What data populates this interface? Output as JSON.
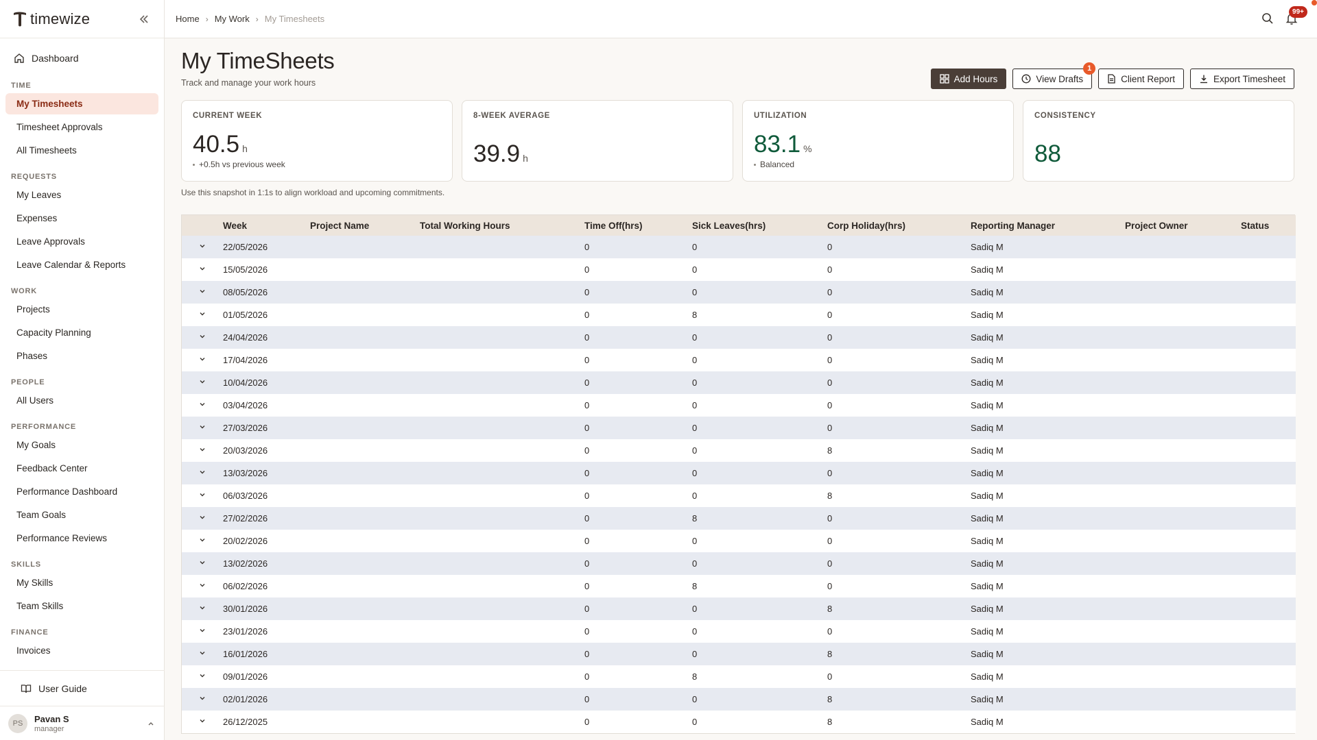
{
  "brand": {
    "name": "timewize"
  },
  "sidebar": {
    "dashboard": "Dashboard",
    "sections": [
      {
        "title": "TIME",
        "items": [
          "My Timesheets",
          "Timesheet Approvals",
          "All Timesheets"
        ]
      },
      {
        "title": "REQUESTS",
        "items": [
          "My Leaves",
          "Expenses",
          "Leave Approvals",
          "Leave Calendar & Reports"
        ]
      },
      {
        "title": "WORK",
        "items": [
          "Projects",
          "Capacity Planning",
          "Phases"
        ]
      },
      {
        "title": "PEOPLE",
        "items": [
          "All Users"
        ]
      },
      {
        "title": "PERFORMANCE",
        "items": [
          "My Goals",
          "Feedback Center",
          "Performance Dashboard",
          "Team Goals",
          "Performance Reviews"
        ]
      },
      {
        "title": "SKILLS",
        "items": [
          "My Skills",
          "Team Skills"
        ]
      },
      {
        "title": "FINANCE",
        "items": [
          "Invoices"
        ]
      }
    ],
    "active_item": "My Timesheets",
    "user_guide": "User Guide",
    "user": {
      "initials": "PS",
      "name": "Pavan S",
      "role": "manager"
    }
  },
  "breadcrumb": [
    "Home",
    "My Work",
    "My Timesheets"
  ],
  "notifications": {
    "badge": "99+"
  },
  "page": {
    "title": "My TimeSheets",
    "subtitle": "Track and manage your work hours",
    "hint": "Use this snapshot in 1:1s to align workload and upcoming commitments."
  },
  "actions": {
    "add_hours": "Add Hours",
    "view_drafts": "View Drafts",
    "drafts_count": "1",
    "client_report": "Client Report",
    "export": "Export Timesheet"
  },
  "stats": [
    {
      "label": "CURRENT WEEK",
      "value": "40.5",
      "unit": "h",
      "note": "+0.5h vs previous week",
      "green": false
    },
    {
      "label": "8-WEEK AVERAGE",
      "value": "39.9",
      "unit": "h",
      "note": "",
      "green": false
    },
    {
      "label": "UTILIZATION",
      "value": "83.1",
      "unit": "%",
      "note": "Balanced",
      "green": true
    },
    {
      "label": "CONSISTENCY",
      "value": "88",
      "unit": "",
      "note": "",
      "green": true
    }
  ],
  "table": {
    "columns": [
      "Week",
      "Project Name",
      "Total Working Hours",
      "Time Off(hrs)",
      "Sick Leaves(hrs)",
      "Corp Holiday(hrs)",
      "Reporting Manager",
      "Project Owner",
      "Status"
    ],
    "rows": [
      [
        "22/05/2026",
        "",
        "",
        "0",
        "0",
        "0",
        "Sadiq M",
        "",
        ""
      ],
      [
        "15/05/2026",
        "",
        "",
        "0",
        "0",
        "0",
        "Sadiq M",
        "",
        ""
      ],
      [
        "08/05/2026",
        "",
        "",
        "0",
        "0",
        "0",
        "Sadiq M",
        "",
        ""
      ],
      [
        "01/05/2026",
        "",
        "",
        "0",
        "8",
        "0",
        "Sadiq M",
        "",
        ""
      ],
      [
        "24/04/2026",
        "",
        "",
        "0",
        "0",
        "0",
        "Sadiq M",
        "",
        ""
      ],
      [
        "17/04/2026",
        "",
        "",
        "0",
        "0",
        "0",
        "Sadiq M",
        "",
        ""
      ],
      [
        "10/04/2026",
        "",
        "",
        "0",
        "0",
        "0",
        "Sadiq M",
        "",
        ""
      ],
      [
        "03/04/2026",
        "",
        "",
        "0",
        "0",
        "0",
        "Sadiq M",
        "",
        ""
      ],
      [
        "27/03/2026",
        "",
        "",
        "0",
        "0",
        "0",
        "Sadiq M",
        "",
        ""
      ],
      [
        "20/03/2026",
        "",
        "",
        "0",
        "0",
        "8",
        "Sadiq M",
        "",
        ""
      ],
      [
        "13/03/2026",
        "",
        "",
        "0",
        "0",
        "0",
        "Sadiq M",
        "",
        ""
      ],
      [
        "06/03/2026",
        "",
        "",
        "0",
        "0",
        "8",
        "Sadiq M",
        "",
        ""
      ],
      [
        "27/02/2026",
        "",
        "",
        "0",
        "8",
        "0",
        "Sadiq M",
        "",
        ""
      ],
      [
        "20/02/2026",
        "",
        "",
        "0",
        "0",
        "0",
        "Sadiq M",
        "",
        ""
      ],
      [
        "13/02/2026",
        "",
        "",
        "0",
        "0",
        "0",
        "Sadiq M",
        "",
        ""
      ],
      [
        "06/02/2026",
        "",
        "",
        "0",
        "8",
        "0",
        "Sadiq M",
        "",
        ""
      ],
      [
        "30/01/2026",
        "",
        "",
        "0",
        "0",
        "8",
        "Sadiq M",
        "",
        ""
      ],
      [
        "23/01/2026",
        "",
        "",
        "0",
        "0",
        "0",
        "Sadiq M",
        "",
        ""
      ],
      [
        "16/01/2026",
        "",
        "",
        "0",
        "0",
        "8",
        "Sadiq M",
        "",
        ""
      ],
      [
        "09/01/2026",
        "",
        "",
        "0",
        "8",
        "0",
        "Sadiq M",
        "",
        ""
      ],
      [
        "02/01/2026",
        "",
        "",
        "0",
        "0",
        "8",
        "Sadiq M",
        "",
        ""
      ],
      [
        "26/12/2025",
        "",
        "",
        "0",
        "0",
        "8",
        "Sadiq M",
        "",
        ""
      ]
    ]
  },
  "colors": {
    "accent": "#4a3e37",
    "active_bg": "#fbe6df",
    "green": "#0f5a3a",
    "badge": "#c0281b",
    "orange": "#e85a2a"
  }
}
